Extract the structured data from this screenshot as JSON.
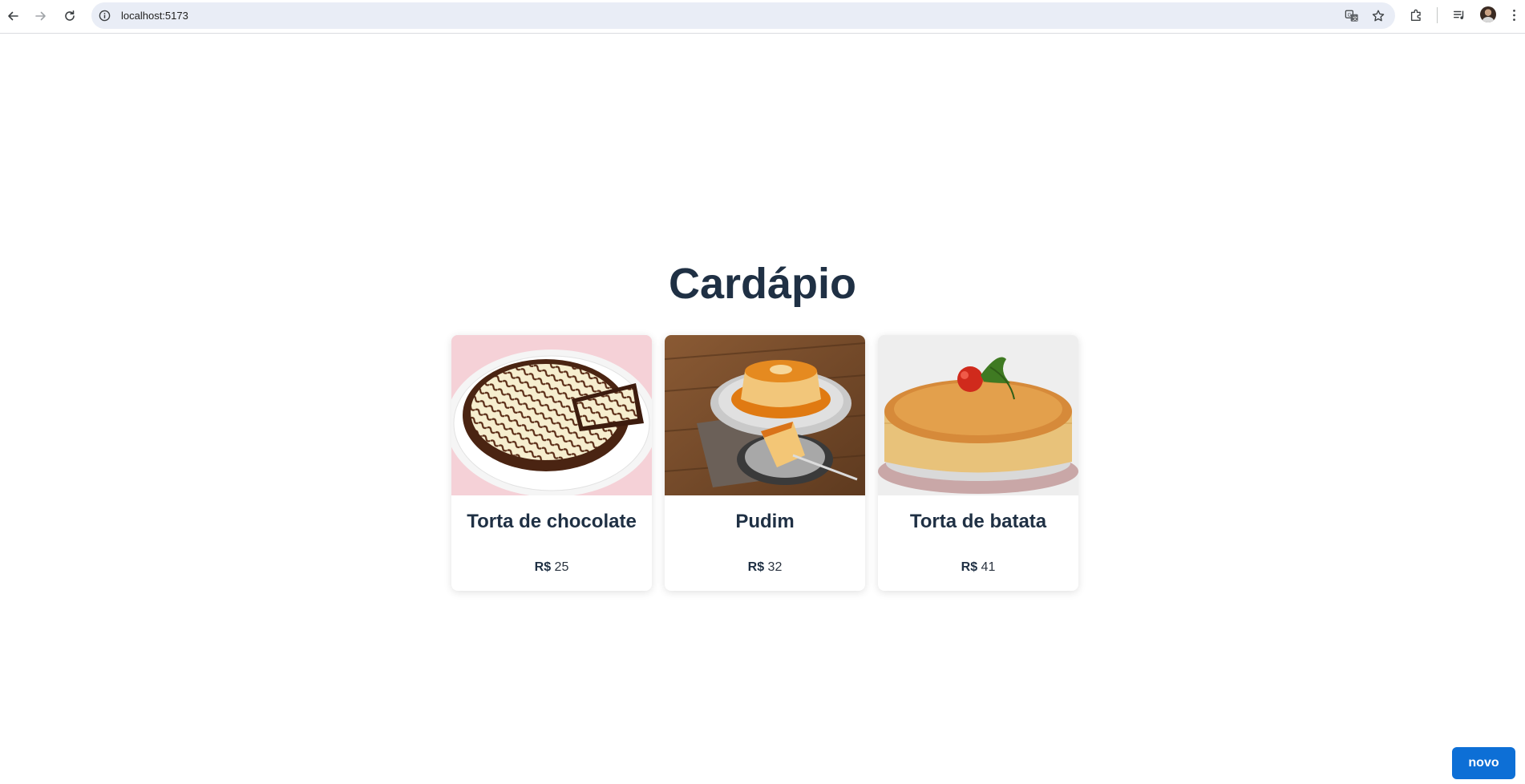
{
  "browser": {
    "url": "localhost:5173"
  },
  "page": {
    "title": "Cardápio"
  },
  "menu": {
    "items": [
      {
        "name": "Torta de chocolate",
        "currency": "R$",
        "price": "25",
        "image": "chocolate-tart-image"
      },
      {
        "name": "Pudim",
        "currency": "R$",
        "price": "32",
        "image": "flan-pudding-image"
      },
      {
        "name": "Torta de batata",
        "currency": "R$",
        "price": "41",
        "image": "potato-pie-image"
      }
    ]
  },
  "actions": {
    "new_label": "novo"
  },
  "colors": {
    "primary_button": "#0d6fd6",
    "heading": "#1f3044"
  }
}
